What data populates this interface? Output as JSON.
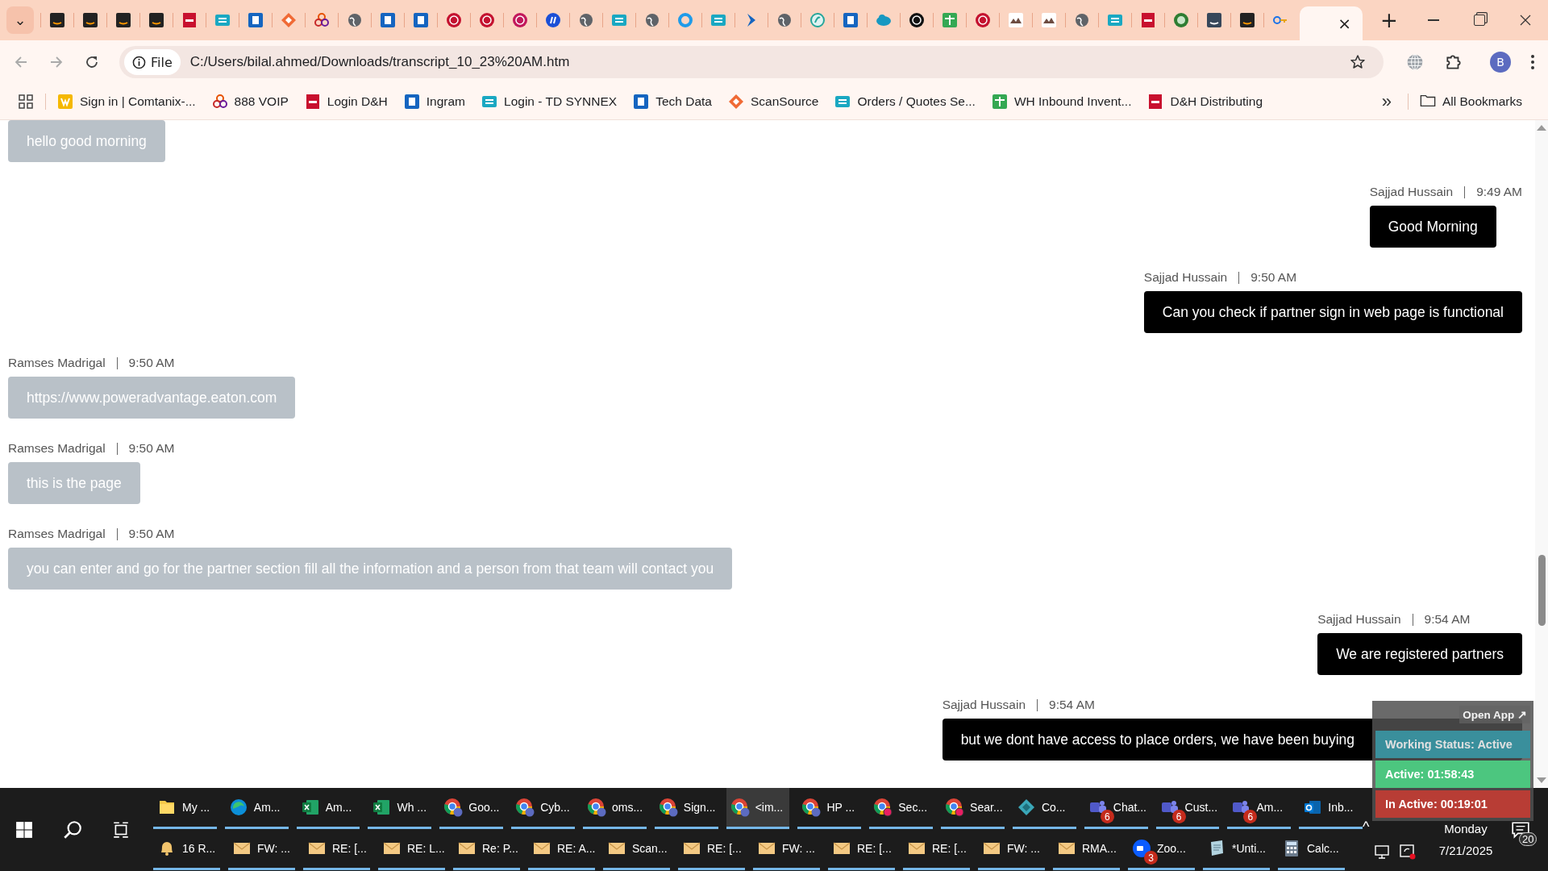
{
  "tab_strip": {
    "tab_search": "⌄",
    "tabs": [
      {
        "kind": "dark-square",
        "selected": false
      },
      {
        "kind": "dark-square",
        "selected": false
      },
      {
        "kind": "dark-square",
        "selected": false
      },
      {
        "kind": "dark-square",
        "selected": false
      },
      {
        "kind": "red-square",
        "selected": false
      },
      {
        "kind": "teal-square",
        "selected": false
      },
      {
        "kind": "blue-square",
        "selected": false
      },
      {
        "kind": "orange-diamond",
        "selected": false
      },
      {
        "kind": "three-rings",
        "selected": false
      },
      {
        "kind": "globe",
        "selected": false
      },
      {
        "kind": "blue-square",
        "selected": false
      },
      {
        "kind": "blue-square",
        "selected": false
      },
      {
        "kind": "red-circle",
        "selected": false
      },
      {
        "kind": "red-circle",
        "selected": false
      },
      {
        "kind": "pink-circle",
        "selected": false
      },
      {
        "kind": "blue-circle",
        "selected": false
      },
      {
        "kind": "globe",
        "selected": false
      },
      {
        "kind": "teal-square",
        "selected": false
      },
      {
        "kind": "globe",
        "selected": false
      },
      {
        "kind": "ring",
        "selected": false
      },
      {
        "kind": "teal-square",
        "selected": false
      },
      {
        "kind": "chevron",
        "selected": false
      },
      {
        "kind": "globe",
        "selected": false
      },
      {
        "kind": "green-ring",
        "selected": false
      },
      {
        "kind": "blue-square",
        "selected": false
      },
      {
        "kind": "cloud",
        "selected": false
      },
      {
        "kind": "black-circle",
        "selected": false
      },
      {
        "kind": "green-square",
        "selected": false
      },
      {
        "kind": "red-circle",
        "selected": false
      },
      {
        "kind": "white-square",
        "selected": false
      },
      {
        "kind": "white-square",
        "selected": false
      },
      {
        "kind": "globe",
        "selected": false
      },
      {
        "kind": "teal-square",
        "selected": false
      },
      {
        "kind": "red-square",
        "selected": false
      },
      {
        "kind": "green-circle",
        "selected": false
      },
      {
        "kind": "slate-square",
        "selected": false
      },
      {
        "kind": "dark-square",
        "selected": false
      },
      {
        "kind": "key",
        "selected": false
      },
      {
        "kind": "none",
        "selected": true,
        "close": "×"
      }
    ],
    "new_tab": "+"
  },
  "toolbar": {
    "chip": "File",
    "url": "C:/Users/bilal.ahmed/Downloads/transcript_10_23%20AM.htm",
    "avatar": "B"
  },
  "bookmarks": {
    "items": [
      {
        "kind": "yellow-square",
        "label": "Sign in | Comtanix-..."
      },
      {
        "kind": "three-rings",
        "label": "888 VOIP"
      },
      {
        "kind": "red-square",
        "label": "Login D&H"
      },
      {
        "kind": "blue-square",
        "label": "Ingram"
      },
      {
        "kind": "teal-square",
        "label": "Login - TD SYNNEX"
      },
      {
        "kind": "blue-square",
        "label": "Tech Data"
      },
      {
        "kind": "orange-diamond",
        "label": "ScanSource"
      },
      {
        "kind": "teal-square",
        "label": "Orders / Quotes Se..."
      },
      {
        "kind": "green-square",
        "label": "WH Inbound Invent..."
      },
      {
        "kind": "red-square",
        "label": "D&H Distributing"
      }
    ],
    "more": "»",
    "all": "All Bookmarks"
  },
  "messages": [
    {
      "kind": "incoming",
      "text": "hello good morning"
    },
    {
      "kind": "outgoing",
      "sender": "Sajjad Hussain",
      "time": "9:49 AM",
      "text": "Good Morning"
    },
    {
      "kind": "outgoing",
      "sender": "Sajjad Hussain",
      "time": "9:50 AM",
      "text": "Can you check if partner sign in web page is functional"
    },
    {
      "kind": "incoming",
      "sender": "Ramses Madrigal",
      "time": "9:50 AM",
      "text": "https://www.poweradvantage.eaton.com"
    },
    {
      "kind": "incoming",
      "sender": "Ramses Madrigal",
      "time": "9:50 AM",
      "text": "this is the page"
    },
    {
      "kind": "incoming",
      "sender": "Ramses Madrigal",
      "time": "9:50 AM",
      "text": "you can enter and go for the partner section fill all the information and a person from that team will contact you"
    },
    {
      "kind": "outgoing",
      "sender": "Sajjad Hussain",
      "time": "9:54 AM",
      "text": "We are registered partners"
    },
    {
      "kind": "outgoing",
      "sender": "Sajjad Hussain",
      "time": "9:54 AM",
      "text": "but we dont have access to place orders, we have been buying"
    }
  ],
  "status_widget": {
    "open_app": "Open App ↗",
    "rows": [
      {
        "kind": "working",
        "text": "Working Status: Active"
      },
      {
        "kind": "active",
        "text": "Active: 01:58:43"
      },
      {
        "kind": "inactive",
        "text": "In Active: 00:19:01"
      }
    ]
  },
  "taskbar": {
    "row_1": [
      {
        "kind": "folder",
        "label": "My ...",
        "selected": false
      },
      {
        "kind": "edge",
        "label": "Am...",
        "selected": false
      },
      {
        "kind": "excel",
        "label": "Am...",
        "selected": false
      },
      {
        "kind": "excel",
        "label": "Wh ...",
        "selected": false
      },
      {
        "kind": "chrome",
        "label": "Goo...",
        "selected": false
      },
      {
        "kind": "chrome",
        "label": "Cyb...",
        "selected": false
      },
      {
        "kind": "chrome",
        "label": "oms...",
        "selected": false
      },
      {
        "kind": "chrome",
        "label": "Sign...",
        "selected": false
      },
      {
        "kind": "chrome",
        "label": "<im...",
        "selected": true
      },
      {
        "kind": "chrome",
        "label": "HP ...",
        "selected": false
      },
      {
        "kind": "chrome-red",
        "label": "Sec...",
        "selected": false
      },
      {
        "kind": "chrome-red",
        "label": "Sear...",
        "selected": false
      },
      {
        "kind": "diamond",
        "label": "Co...",
        "selected": false
      },
      {
        "kind": "teams",
        "label": "Chat...",
        "badge": "6",
        "selected": false
      },
      {
        "kind": "teams",
        "label": "Cust...",
        "badge": "6",
        "selected": false
      },
      {
        "kind": "teams",
        "label": "Am...",
        "badge": "6",
        "selected": false
      },
      {
        "kind": "outlook",
        "label": "Inb...",
        "selected": false
      }
    ],
    "row_2": [
      {
        "kind": "bell",
        "label": "16 R...",
        "selected": false
      },
      {
        "kind": "mail",
        "label": "FW: ...",
        "selected": false
      },
      {
        "kind": "mail",
        "label": "RE: [...",
        "selected": false
      },
      {
        "kind": "mail",
        "label": "RE: L...",
        "selected": false
      },
      {
        "kind": "mail",
        "label": "Re: P...",
        "selected": false
      },
      {
        "kind": "mail",
        "label": "RE: A...",
        "selected": false
      },
      {
        "kind": "mail",
        "label": "Scan...",
        "selected": false
      },
      {
        "kind": "mail",
        "label": "RE: [...",
        "selected": false
      },
      {
        "kind": "mail",
        "label": "FW: ...",
        "selected": false
      },
      {
        "kind": "mail",
        "label": "RE: [...",
        "selected": false
      },
      {
        "kind": "mail",
        "label": "RE: [...",
        "selected": false
      },
      {
        "kind": "mail",
        "label": "FW: ...",
        "selected": false
      },
      {
        "kind": "mail",
        "label": "RMA...",
        "selected": false
      },
      {
        "kind": "zoom",
        "label": "Zoo...",
        "badge": "3",
        "selected": false
      },
      {
        "kind": "notepad",
        "label": "*Unti...",
        "selected": false
      },
      {
        "kind": "calculator",
        "label": "Calc...",
        "selected": false
      }
    ],
    "tray": {
      "chevron": "^",
      "day": "Monday",
      "date": "7/21/2025",
      "notifications": "20"
    }
  }
}
